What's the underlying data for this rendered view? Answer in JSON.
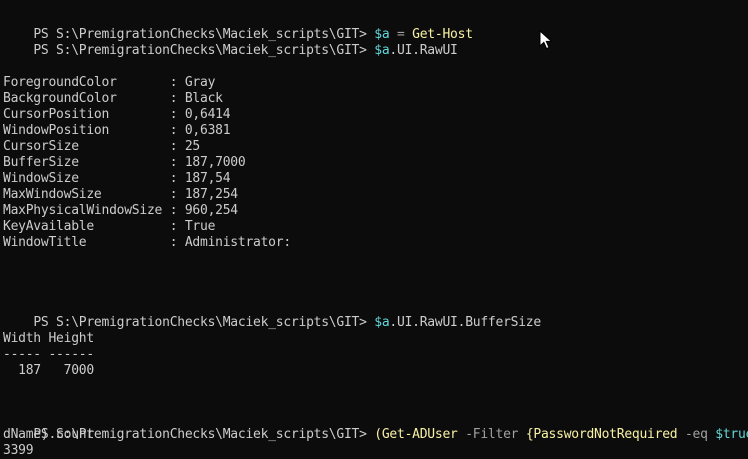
{
  "console": {
    "prompt": "PS S:\\PremigrationChecks\\Maciek_scripts\\GIT> ",
    "cmd1": {
      "var": "$a",
      "op": " = ",
      "cmdlet": "Get-Host"
    },
    "cmd2": {
      "var": "$a",
      "member": ".UI.RawUI"
    },
    "rawui": [
      {
        "name": "ForegroundColor       ",
        "sep": ": ",
        "value": "Gray"
      },
      {
        "name": "BackgroundColor       ",
        "sep": ": ",
        "value": "Black"
      },
      {
        "name": "CursorPosition        ",
        "sep": ": ",
        "value": "0,6414"
      },
      {
        "name": "WindowPosition        ",
        "sep": ": ",
        "value": "0,6381"
      },
      {
        "name": "CursorSize            ",
        "sep": ": ",
        "value": "25"
      },
      {
        "name": "BufferSize            ",
        "sep": ": ",
        "value": "187,7000"
      },
      {
        "name": "WindowSize            ",
        "sep": ": ",
        "value": "187,54"
      },
      {
        "name": "MaxWindowSize         ",
        "sep": ": ",
        "value": "187,254"
      },
      {
        "name": "MaxPhysicalWindowSize ",
        "sep": ": ",
        "value": "960,254"
      },
      {
        "name": "KeyAvailable          ",
        "sep": ": ",
        "value": "True"
      },
      {
        "name": "WindowTitle           ",
        "sep": ": ",
        "value": "Administrator:"
      }
    ],
    "cmd3": {
      "var": "$a",
      "member": ".UI.RawUI.BufferSize"
    },
    "buffer_table": {
      "header": "Width Height",
      "rule": "----- ------",
      "row": "  187   7000"
    },
    "cmd4": {
      "open_paren": "(",
      "cmdlet": "Get-ADUser",
      "param": " -Filter ",
      "brace_open": "{",
      "prop": "PasswordNotRequired",
      "op": " -eq ",
      "val": "$true",
      "brace_close": "}"
    },
    "cmd4_cont": "dName).count",
    "result": "3399"
  },
  "colors": {
    "background": "#0c0c0c",
    "text": "#cccccc",
    "command": "#f9f1a5",
    "parameter": "#a0a0a0",
    "variable": "#61d6d6"
  },
  "icons": {
    "pointer": "mouse-pointer-icon"
  }
}
